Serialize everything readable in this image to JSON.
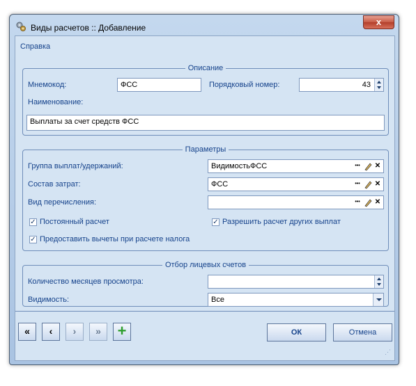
{
  "window": {
    "title": "Виды расчетов :: Добавление",
    "close_glyph": "x"
  },
  "menu": {
    "help": "Справка"
  },
  "description_group": {
    "legend": "Описание",
    "mnemocode_label": "Мнемокод:",
    "mnemocode_value": "ФСС",
    "order_label": "Порядковый номер:",
    "order_value": "43",
    "name_label": "Наименование:",
    "name_value": "Выплаты за счет средств ФСС"
  },
  "params_group": {
    "legend": "Параметры",
    "group_label": "Группа выплат/удержаний:",
    "group_value": "ВидимостьФСС",
    "cost_label": "Состав затрат:",
    "cost_value": "ФСС",
    "transfer_label": "Вид перечисления:",
    "transfer_value": "",
    "permanent_label": "Постоянный расчет",
    "permanent_checked": true,
    "allow_other_label": "Разрешить расчет других выплат",
    "allow_other_checked": true,
    "deductions_label": "Предоставить вычеты при расчете налога",
    "deductions_checked": true,
    "ellipsis_glyph": "•••",
    "clear_glyph": "✕"
  },
  "accounts_group": {
    "legend": "Отбор лицевых счетов",
    "months_label": "Количество месяцев просмотра:",
    "months_value": "",
    "visibility_label": "Видимость:",
    "visibility_value": "Все"
  },
  "footer": {
    "first_glyph": "«",
    "prev_glyph": "‹",
    "next_glyph": "›",
    "last_glyph": "»",
    "add_glyph": "+",
    "ok_label": "ОК",
    "cancel_label": "Отмена"
  },
  "colors": {
    "accent": "#15428b",
    "add_green": "#2e9e2e"
  }
}
